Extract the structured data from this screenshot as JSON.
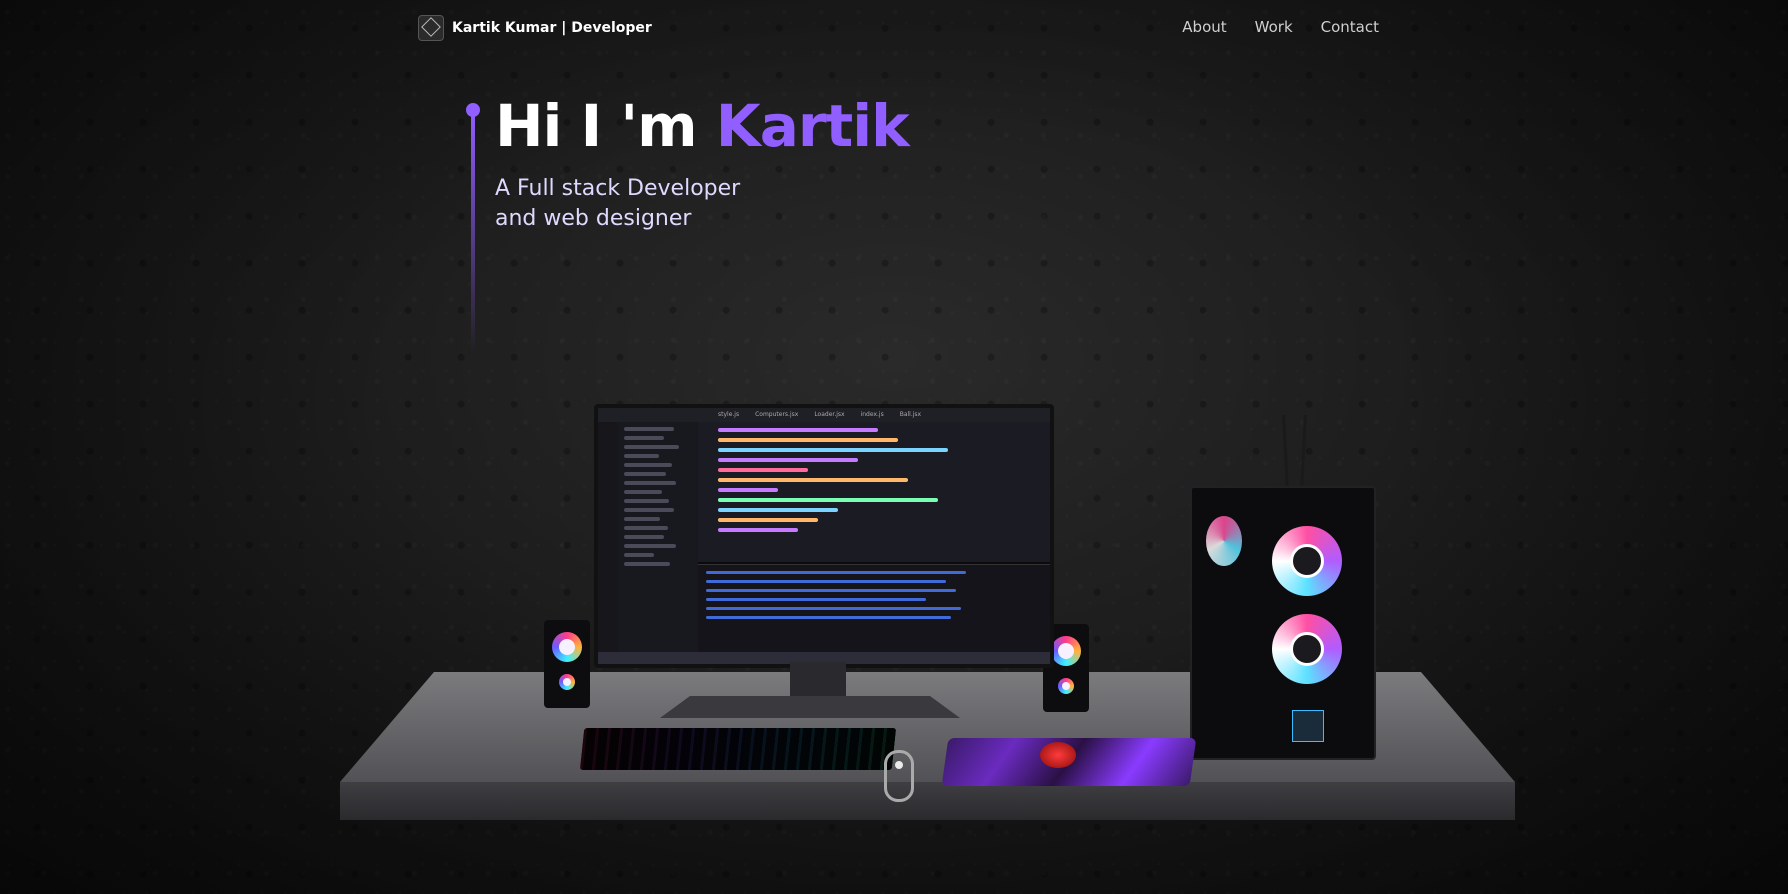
{
  "nav": {
    "brand": "Kartik Kumar | Developer",
    "links": [
      "About",
      "Work",
      "Contact"
    ]
  },
  "hero": {
    "greeting": "Hi I 'm",
    "name": "Kartik",
    "subtitle_line1": "A Full stack Developer",
    "subtitle_line2": "and web designer"
  },
  "scene": {
    "monitor_tabs": [
      "style.js",
      "Computers.jsx",
      "Loader.jsx",
      "index.js",
      "Ball.jsx"
    ]
  },
  "colors": {
    "accent": "#915eff",
    "background": "#1c1c1c",
    "text": "#ffffff"
  }
}
